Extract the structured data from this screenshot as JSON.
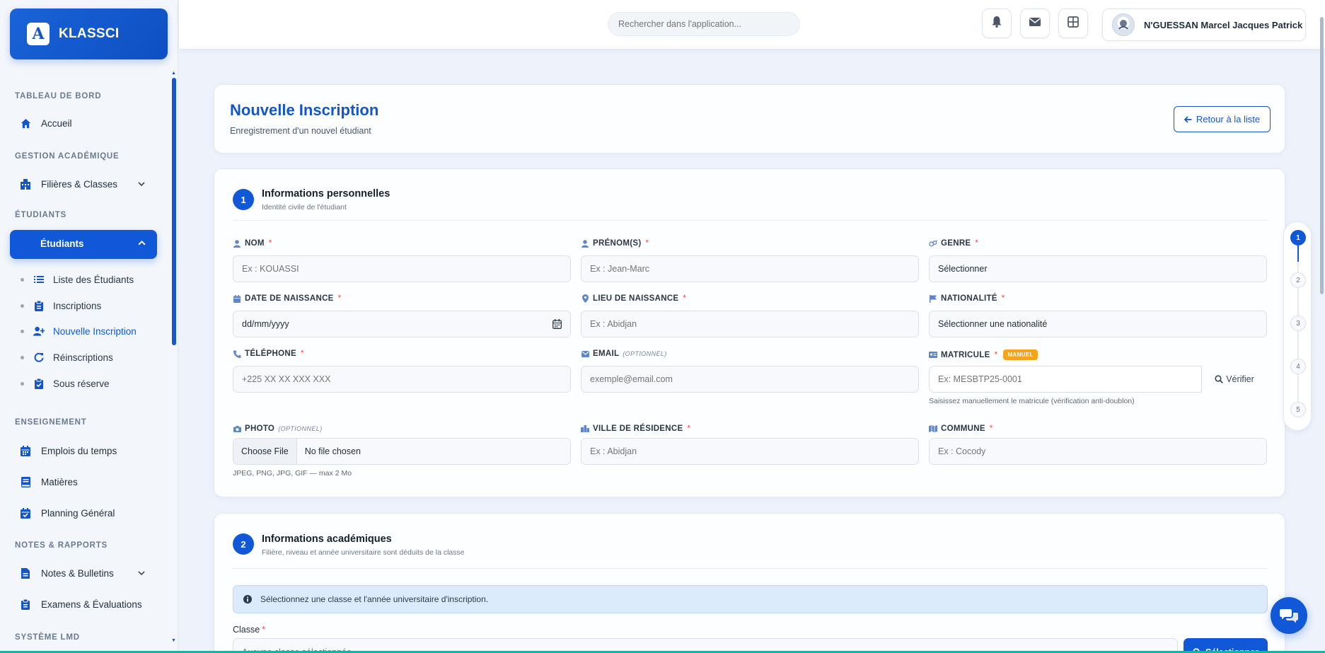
{
  "app": {
    "name": "KLASSCI",
    "logo_letter": "A"
  },
  "sidebar": {
    "sections": {
      "dashboard": "TABLEAU DE BORD",
      "academic": "GESTION ACADÉMIQUE",
      "students": "ÉTUDIANTS",
      "teaching": "ENSEIGNEMENT",
      "notes": "NOTES & RAPPORTS",
      "lmd": "SYSTÈME LMD"
    },
    "items": {
      "home": "Accueil",
      "filieres": "Filières & Classes",
      "students": "Étudiants",
      "list": "Liste des Étudiants",
      "inscriptions": "Inscriptions",
      "new_inscription": "Nouvelle Inscription",
      "reinscriptions": "Réinscriptions",
      "reserve": "Sous réserve",
      "timetable": "Emplois du temps",
      "subjects": "Matières",
      "planning": "Planning Général",
      "bulletins": "Notes & Bulletins",
      "exams": "Examens & Évaluations"
    },
    "accent": "#1158d8"
  },
  "topbar": {
    "search_placeholder": "Rechercher dans l'application...",
    "user_name": "N'GUESSAN Marcel Jacques Patrick",
    "icons": [
      "bell-icon",
      "mail-icon",
      "grid-icon"
    ]
  },
  "header": {
    "title": "Nouvelle Inscription",
    "subtitle": "Enregistrement d'un nouvel étudiant",
    "back_label": "Retour à la liste"
  },
  "section1": {
    "number": "1",
    "title": "Informations personnelles",
    "subtitle": "Identité civile de l'étudiant",
    "required_mark": "*",
    "optional_tag": "(OPTIONNEL)",
    "fields": {
      "nom": {
        "label": "NOM",
        "placeholder": "Ex : KOUASSI"
      },
      "prenom": {
        "label": "PRÉNOM(S)",
        "placeholder": "Ex : Jean-Marc"
      },
      "genre": {
        "label": "GENRE",
        "value": "Sélectionner"
      },
      "naissance": {
        "label": "DATE DE NAISSANCE",
        "placeholder": "dd/mm/yyyy"
      },
      "lieu": {
        "label": "LIEU DE NAISSANCE",
        "placeholder": "Ex : Abidjan"
      },
      "nationalite": {
        "label": "NATIONALITÉ",
        "value": "Sélectionner une nationalité"
      },
      "telephone": {
        "label": "TÉLÉPHONE",
        "placeholder": "+225 XX XX XXX XXX"
      },
      "email": {
        "label": "EMAIL",
        "placeholder": "exemple@email.com"
      },
      "matricule": {
        "label": "MATRICULE",
        "badge": "MANUEL",
        "placeholder": "Ex: MESBTP25-0001",
        "verify_label": "Vérifier",
        "hint": "Saisissez manuellement le matricule (vérification anti-doublon)"
      },
      "photo": {
        "label": "PHOTO",
        "button": "Choose File",
        "status": "No file chosen",
        "hint": "JPEG, PNG, JPG, GIF — max 2 Mo"
      },
      "ville": {
        "label": "VILLE DE RÉSIDENCE",
        "placeholder": "Ex : Abidjan"
      },
      "commune": {
        "label": "COMMUNE",
        "placeholder": "Ex : Cocody"
      }
    }
  },
  "section2": {
    "number": "2",
    "title": "Informations académiques",
    "subtitle": "Filière, niveau et année universitaire sont déduits de la classe",
    "info": "Sélectionnez une classe et l'année universitaire d'inscription.",
    "class_label": "Classe",
    "required_mark": "*",
    "class_placeholder": "Aucune classe sélectionnée",
    "select_label": "Sélectionner"
  },
  "stepper": {
    "steps": [
      "1",
      "2",
      "3",
      "4",
      "5"
    ],
    "active": 1
  }
}
